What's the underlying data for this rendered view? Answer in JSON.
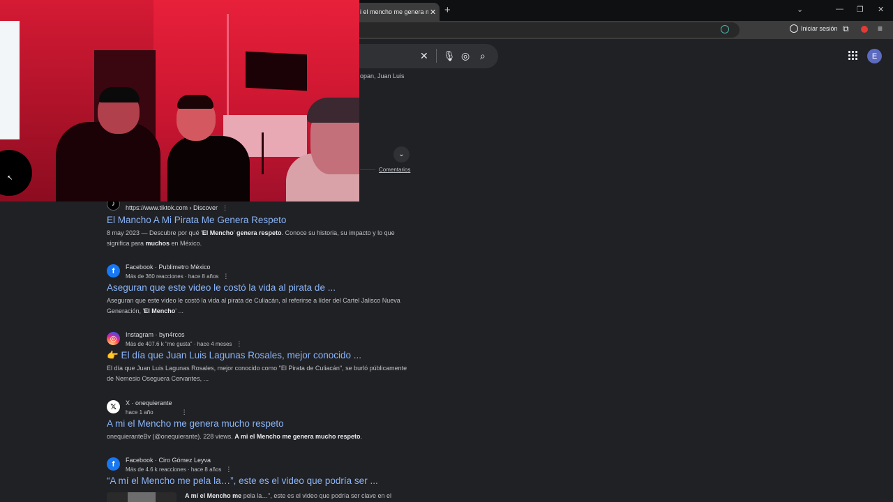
{
  "browser": {
    "tab_title": "i el mencho me genera mucho",
    "tab_close": "✕",
    "new_tab": "+",
    "signin_label": "Iniciar sesión",
    "window_controls": [
      "⌄",
      "—",
      "❐",
      "✕"
    ]
  },
  "search": {
    "clear_icon": "✕",
    "partial_text": "opan, Juan Luis",
    "comments_link": "Comentarios",
    "avatar_letter": "E"
  },
  "results": [
    {
      "icon": "tiktok-icon",
      "source_line1": "https://www.tiktok.com › Discover",
      "source_line2": "",
      "title": "El Mancho A Mi Pirata Me Genera Respeto",
      "snippet_parts": [
        {
          "t": "8 may 2023 — Descubre por qué '",
          "b": false
        },
        {
          "t": "El Mencho",
          "b": true
        },
        {
          "t": "' ",
          "b": false
        },
        {
          "t": "genera respeto",
          "b": true
        },
        {
          "t": ". Conoce su historia, su impacto y lo que significa para ",
          "b": false
        },
        {
          "t": "muchos",
          "b": true
        },
        {
          "t": " en México.",
          "b": false
        }
      ]
    },
    {
      "icon": "facebook-icon",
      "source_line1": "Facebook · Publimetro México",
      "source_line2": "Más de 360 reacciones · hace 8 años",
      "title": "Aseguran que este video le costó la vida al pirata de ...",
      "snippet_parts": [
        {
          "t": "Aseguran que este video le costó la vida al pirata de Culiacán, al referirse a líder del Cartel Jalisco Nueva Generación, '",
          "b": false
        },
        {
          "t": "El Mencho",
          "b": true
        },
        {
          "t": "' ...",
          "b": false
        }
      ]
    },
    {
      "icon": "instagram-icon",
      "source_line1": "Instagram · byn4rcos",
      "source_line2": "Más de 407.6 k \"me gusta\" · hace 4 meses",
      "title": "👉 El día que Juan Luis Lagunas Rosales, mejor conocido ...",
      "snippet_parts": [
        {
          "t": "El día que Juan Luis Lagunas Rosales, mejor conocido como \"El Pirata de Culiacán\", se burló públicamente de Nemesio Oseguera Cervantes, ...",
          "b": false
        }
      ]
    },
    {
      "icon": "x-icon",
      "source_line1": "X · onequierante",
      "source_line2": "hace 1 año",
      "title": "A mi el Mencho me genera mucho respeto",
      "snippet_parts": [
        {
          "t": "onequieranteBv (@onequierante). 228 views. ",
          "b": false
        },
        {
          "t": "A mi el Mencho me genera mucho respeto",
          "b": true
        },
        {
          "t": ".",
          "b": false
        }
      ]
    },
    {
      "icon": "facebook-icon",
      "source_line1": "Facebook · Ciro Gómez Leyva",
      "source_line2": "Más de 4.6 k reacciones · hace 8 años",
      "title": "“A mí el Mencho me pela la…”, este es el video que podría ser ...",
      "snippet_parts": [
        {
          "t": "A mí el Mencho me",
          "b": true
        },
        {
          "t": " pela la…\", este es el video que podría ser clave en el",
          "b": false
        }
      ]
    }
  ],
  "colors": {
    "link": "#8ab4f8",
    "background": "#202124",
    "snippet": "#bdc1c6"
  }
}
